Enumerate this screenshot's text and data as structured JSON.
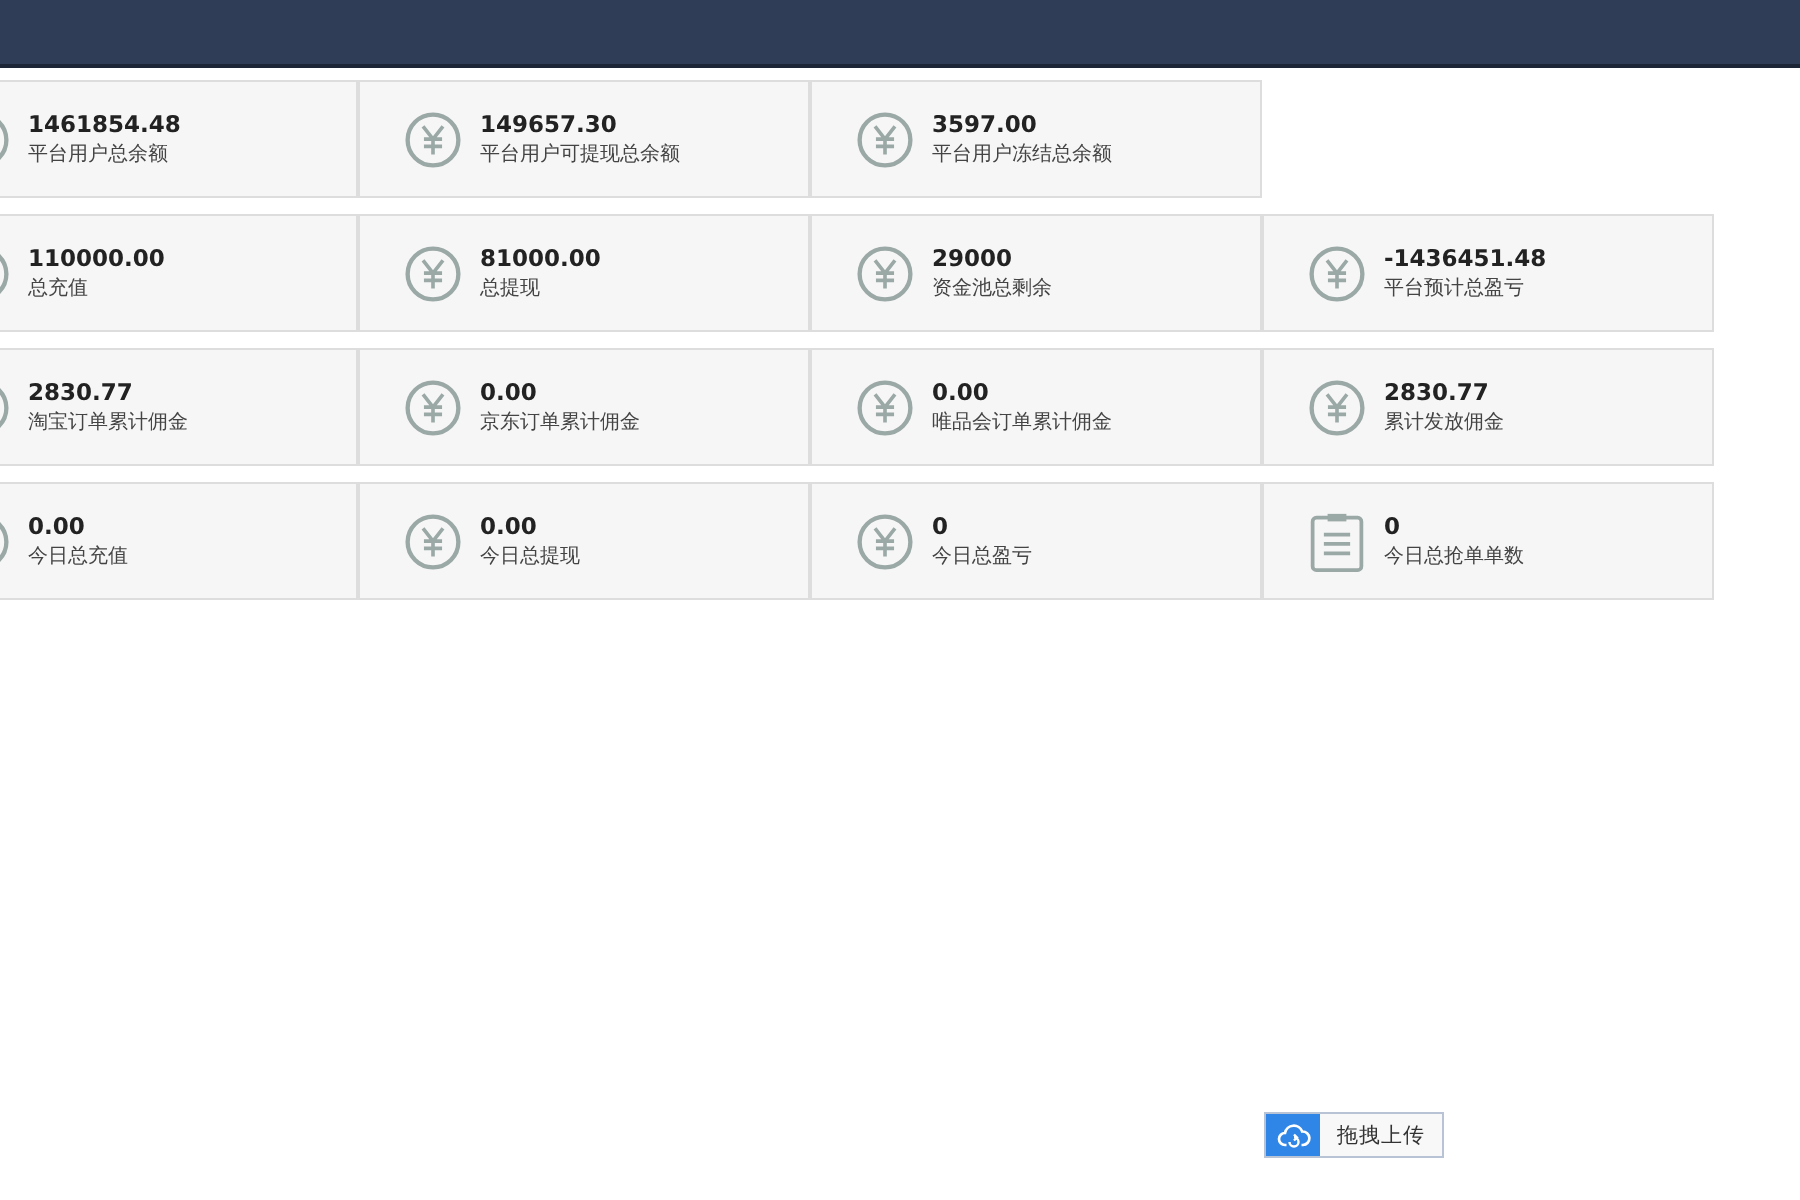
{
  "stat_rows": [
    [
      {
        "value": "1461854.48",
        "label": "平台用户总余额",
        "kind": "money"
      },
      {
        "value": "149657.30",
        "label": "平台用户可提现总余额",
        "kind": "money"
      },
      {
        "value": "3597.00",
        "label": "平台用户冻结总余额",
        "kind": "money"
      }
    ],
    [
      {
        "value": "110000.00",
        "label": "总充值",
        "kind": "money"
      },
      {
        "value": "81000.00",
        "label": "总提现",
        "kind": "money"
      },
      {
        "value": "29000",
        "label": "资金池总剩余",
        "kind": "money"
      },
      {
        "value": "-1436451.48",
        "label": "平台预计总盈亏",
        "kind": "money"
      }
    ],
    [
      {
        "value": "2830.77",
        "label": "淘宝订单累计佣金",
        "kind": "money"
      },
      {
        "value": "0.00",
        "label": "京东订单累计佣金",
        "kind": "money"
      },
      {
        "value": "0.00",
        "label": "唯品会订单累计佣金",
        "kind": "money"
      },
      {
        "value": "2830.77",
        "label": "累计发放佣金",
        "kind": "money"
      }
    ],
    [
      {
        "value": "0.00",
        "label": "今日总充值",
        "kind": "money"
      },
      {
        "value": "0.00",
        "label": "今日总提现",
        "kind": "money"
      },
      {
        "value": "0",
        "label": "今日总盈亏",
        "kind": "money"
      },
      {
        "value": "0",
        "label": "今日总抢单单数",
        "kind": "orders"
      }
    ]
  ],
  "upload_button": {
    "label": "拖拽上传"
  }
}
